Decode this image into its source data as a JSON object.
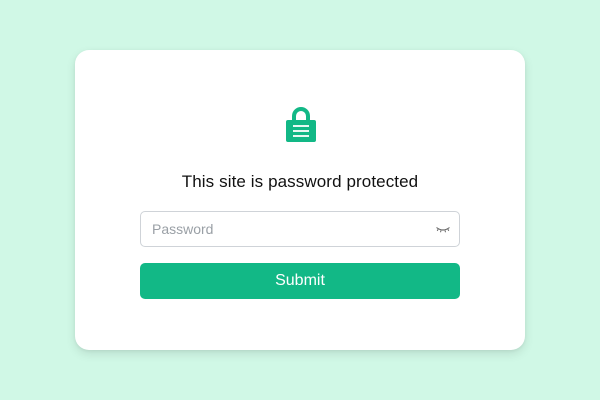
{
  "colors": {
    "page_background": "#d0f8e6",
    "card_background": "#ffffff",
    "accent": "#12b886",
    "lock_icon": "#12b886",
    "input_border": "#cfd3d8",
    "placeholder": "#9aa0a6",
    "title_text": "#111111"
  },
  "lock": {
    "icon": "lock-icon"
  },
  "title": "This site is password protected",
  "password_field": {
    "placeholder": "Password",
    "value": "",
    "toggle_icon": "eye-closed-icon"
  },
  "submit": {
    "label": "Submit"
  }
}
